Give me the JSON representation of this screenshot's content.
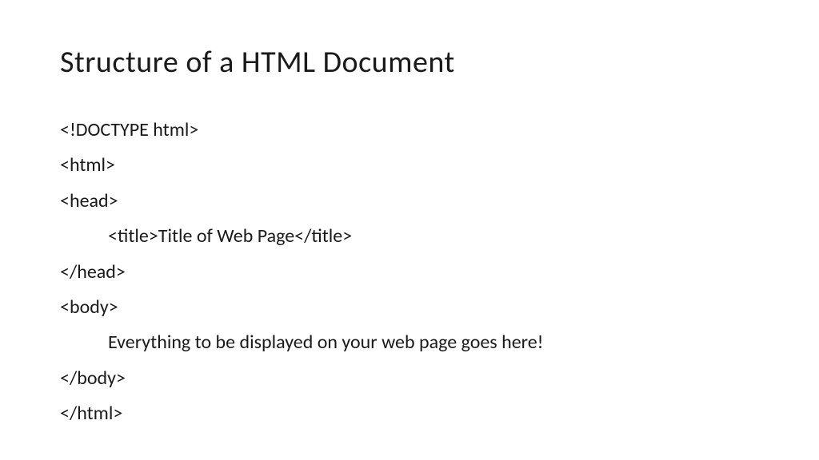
{
  "slide": {
    "title": "Structure of a HTML Document",
    "code": {
      "line1": "<!DOCTYPE html>",
      "line2": "<html>",
      "line3": "<head>",
      "line4": "<title>Title of Web Page</title>",
      "line5": "</head>",
      "line6": "<body>",
      "line7": "Everything to be displayed on your web page goes here!",
      "line8": "</body>",
      "line9": "</html>"
    }
  }
}
